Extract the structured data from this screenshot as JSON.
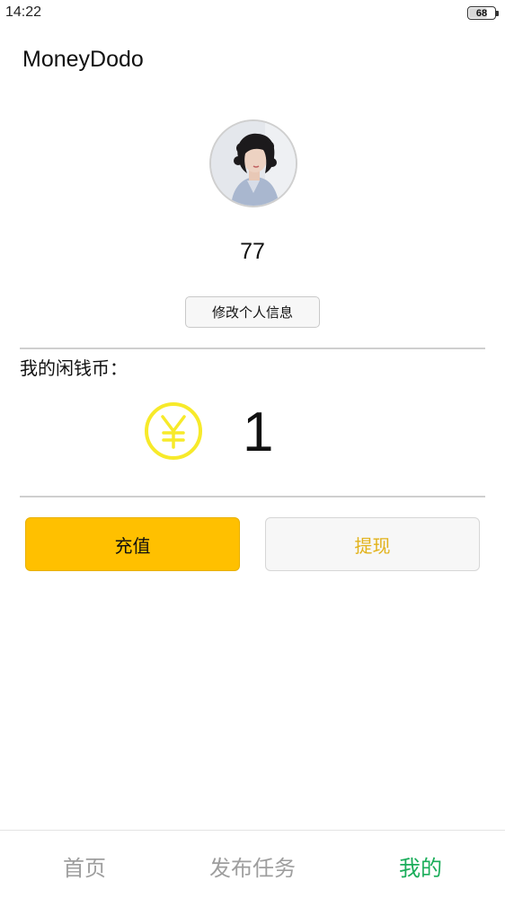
{
  "status_bar": {
    "time": "14:22",
    "battery": "68",
    "battery_level": 0.68
  },
  "app": {
    "title": "MoneyDodo"
  },
  "profile": {
    "username": "77",
    "edit_button": "修改个人信息"
  },
  "wallet": {
    "label": "我的闲钱币：",
    "coin_icon": "yen-coin-icon",
    "amount": "1",
    "coin_color": "#f7ea2a"
  },
  "actions": {
    "recharge": "充值",
    "withdraw": "提现"
  },
  "colors": {
    "accent_yellow": "#ffc000",
    "withdraw_text": "#e2b21a",
    "nav_active": "#1aad5a",
    "nav_inactive": "#9e9e9e"
  },
  "bottom_nav": {
    "items": [
      {
        "label": "首页",
        "active": false
      },
      {
        "label": "发布任务",
        "active": false
      },
      {
        "label": "我的",
        "active": true
      }
    ]
  }
}
